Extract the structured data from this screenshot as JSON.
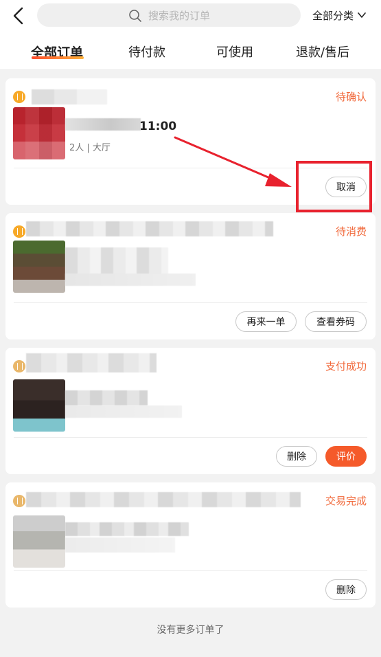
{
  "header": {
    "search_placeholder": "搜索我的订单",
    "category_label": "全部分类"
  },
  "tabs": [
    {
      "label": "全部订单",
      "active": true
    },
    {
      "label": "待付款",
      "active": false
    },
    {
      "label": "可使用",
      "active": false
    },
    {
      "label": "退款/售后",
      "active": false
    }
  ],
  "orders": [
    {
      "status": "待确认",
      "time": "11:00",
      "detail": "2人 | 大厅",
      "buttons": [
        "取消"
      ]
    },
    {
      "status": "待消费",
      "buttons": [
        "再来一单",
        "查看券码"
      ]
    },
    {
      "status": "支付成功",
      "buttons": [
        "删除",
        "评价"
      ]
    },
    {
      "status": "交易完成",
      "buttons": [
        "删除"
      ]
    }
  ],
  "footer": {
    "no_more": "没有更多订单了"
  },
  "colors": {
    "accent": "#f55a2a",
    "status": "#f1683a",
    "annotation": "#e8222e"
  }
}
